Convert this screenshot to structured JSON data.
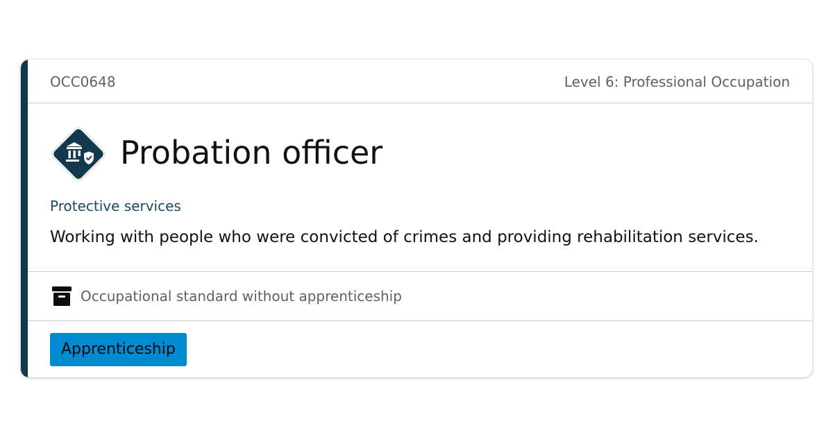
{
  "header": {
    "code": "OCC0648",
    "level": "Level 6: Professional Occupation"
  },
  "occupation": {
    "icon": "protective-services-icon",
    "title": "Probation officer",
    "route": "Protective services",
    "description": "Working with people who were convicted of crimes and providing rehabilitation services."
  },
  "status": {
    "icon": "archive-box-icon",
    "text": "Occupational standard without apprenticeship"
  },
  "tags": {
    "apprenticeship_label": "Apprenticeship"
  },
  "colors": {
    "accent": "#12384d",
    "route_text": "#1a4a5c",
    "tag_background": "#008ad1",
    "muted_text": "#5f6061"
  }
}
